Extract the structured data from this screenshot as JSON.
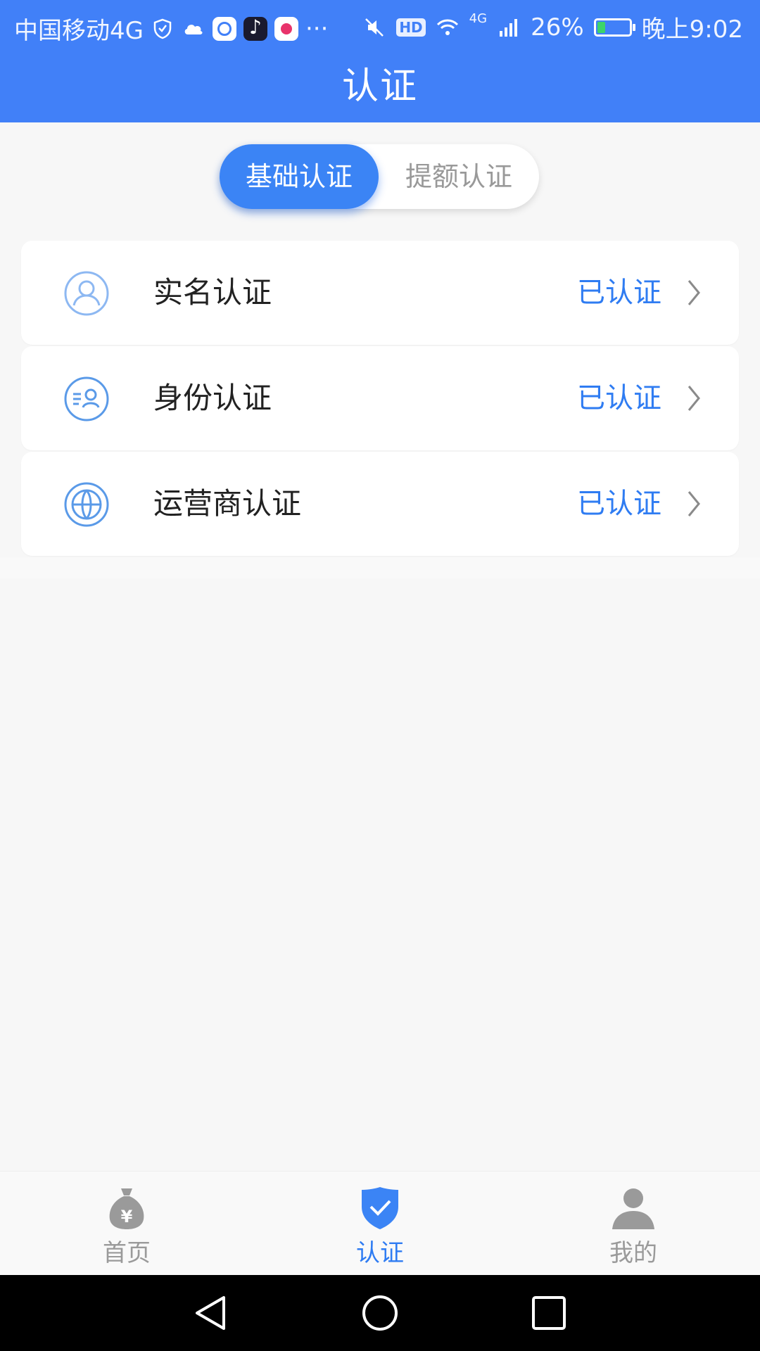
{
  "status_bar": {
    "carrier": "中国移动4G",
    "ellipsis": "···",
    "hd": "HD",
    "network": "4G",
    "battery_percent": "26%",
    "battery_level": 0.26,
    "time": "晚上9:02"
  },
  "header": {
    "title": "认证"
  },
  "segment": {
    "active_label": "基础认证",
    "inactive_label": "提额认证"
  },
  "list": {
    "items": [
      {
        "label": "实名认证",
        "status": "已认证",
        "icon": "user-icon"
      },
      {
        "label": "身份认证",
        "status": "已认证",
        "icon": "id-card-icon"
      },
      {
        "label": "运营商认证",
        "status": "已认证",
        "icon": "globe-icon"
      }
    ]
  },
  "tabbar": {
    "items": [
      {
        "label": "首页",
        "icon": "money-bag-icon",
        "active": false
      },
      {
        "label": "认证",
        "icon": "shield-check-icon",
        "active": true
      },
      {
        "label": "我的",
        "icon": "person-icon",
        "active": false
      }
    ]
  },
  "colors": {
    "brand": "#4180f8",
    "accent": "#2f7cf2",
    "inactive": "#9a9a9a",
    "background": "#f7f7f7"
  }
}
